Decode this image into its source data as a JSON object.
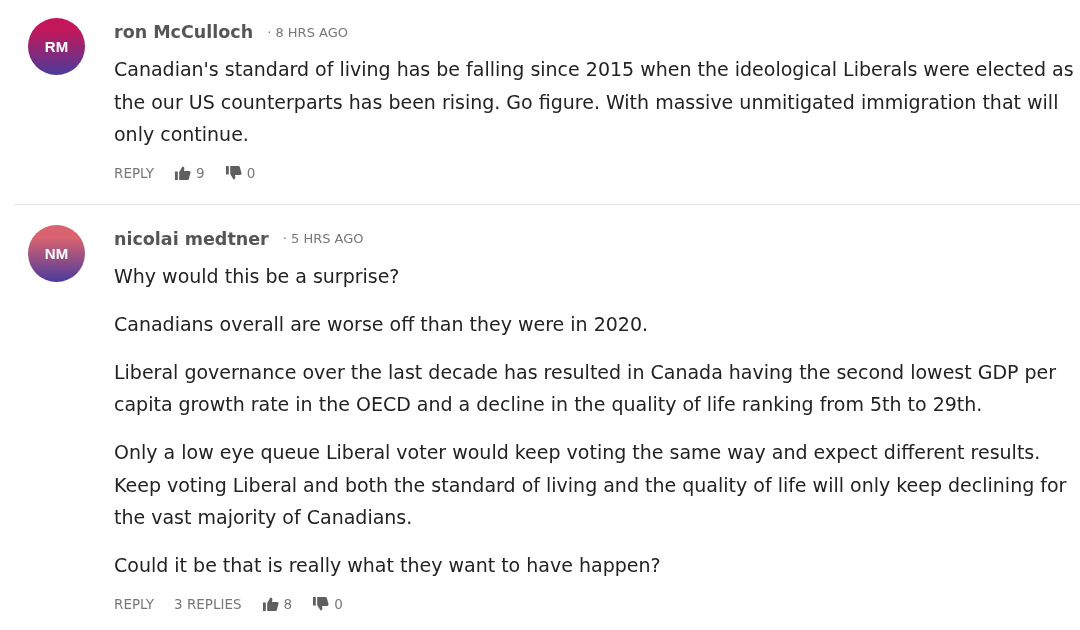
{
  "comments": [
    {
      "initials": "RM",
      "color": "#c2185b",
      "author": "ron McCulloch",
      "time": "· 8 HRS AGO",
      "paragraphs": [
        "Canadian's standard of living has be falling since 2015 when the ideological Liberals were elected as the our US counterparts has been rising. Go figure. With massive unmitigated immigration that will only continue."
      ],
      "reply": "REPLY",
      "likes": "9",
      "dislikes": "0"
    },
    {
      "initials": "NM",
      "color": "#d9636f",
      "author": "nicolai medtner",
      "time": "· 5 HRS AGO",
      "paragraphs": [
        "Why would this be a surprise?",
        "Canadians overall are worse off than they were in 2020.",
        "Liberal governance over the last decade has resulted in Canada having the second lowest GDP per capita growth rate in the OECD and a decline in the quality of life ranking from 5th to 29th.",
        "Only a low eye queue Liberal voter would keep voting the same way and expect different results. Keep voting Liberal and both the standard of living and the quality of life will only keep declining for the vast majority of Canadians.",
        "Could it be that is really what they want to have happen?"
      ],
      "reply": "REPLY",
      "replies": "3 REPLIES",
      "likes": "8",
      "dislikes": "0"
    }
  ]
}
